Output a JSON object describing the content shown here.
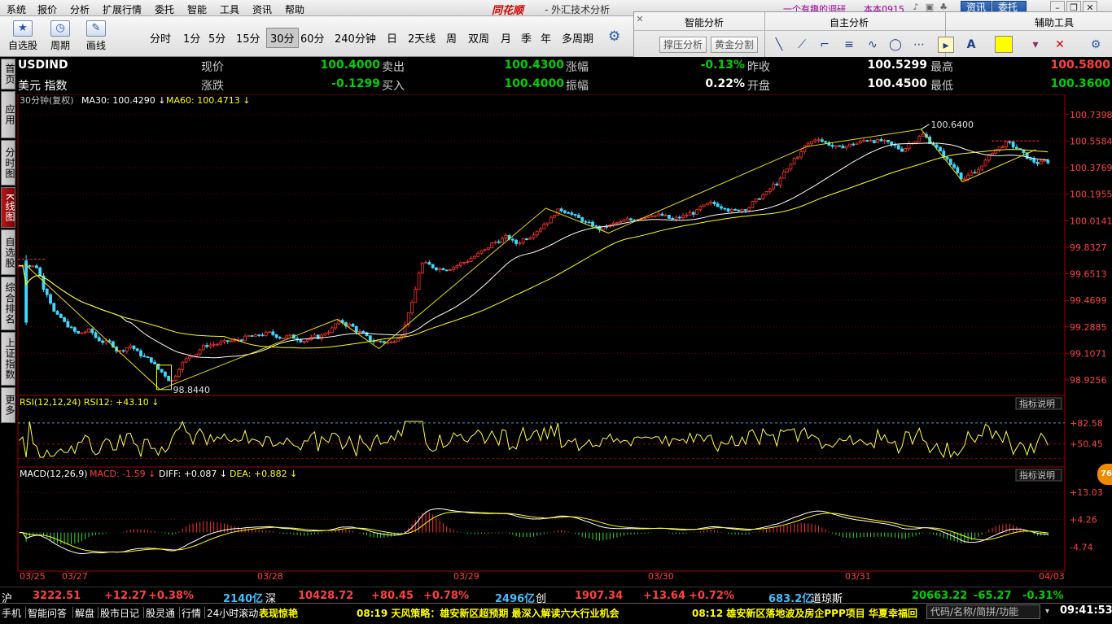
{
  "menu": {
    "items": [
      "系统",
      "报价",
      "分析",
      "扩展行情",
      "委托",
      "智能",
      "工具",
      "资讯",
      "帮助"
    ],
    "brand": "同花顺",
    "title": "- 外汇技术分析",
    "promo": "一个有趣的调研",
    "user": "本本0915",
    "news_btn": "资讯",
    "trade_btn": "委托",
    "trade_btn_arrow": "▾"
  },
  "toolbar": {
    "left_tools": [
      {
        "label": "自选股",
        "icon": "★"
      },
      {
        "label": "周期",
        "icon": "◷"
      },
      {
        "label": "画线",
        "icon": "✎"
      }
    ],
    "periods": [
      "分时",
      "1分",
      "5分",
      "15分",
      "30分",
      "60分",
      "240分钟",
      "日",
      "2天线",
      "周",
      "双周",
      "月",
      "季",
      "年",
      "多周期"
    ],
    "active_period": "30分",
    "panels": {
      "smart": "智能分析",
      "self": "自主分析",
      "aux": "辅助工具"
    },
    "smart_buttons": [
      "撑压分析",
      "黄金分割"
    ],
    "draw_icons": [
      "╲",
      "⟋",
      "⌐",
      "≡",
      "∿",
      "◯",
      "⋯"
    ],
    "pointer_icon": "▸",
    "text_icon": "A",
    "aux_icons": [
      "▾",
      "✕",
      "⚙"
    ]
  },
  "lefttabs": [
    "首页",
    "应用",
    "分时图",
    "K线图",
    "自选股",
    "综合排名",
    "上证指数",
    "更多"
  ],
  "quote": {
    "symbol": "USDIND",
    "name": "美元 指数",
    "row1": [
      {
        "label": "现价",
        "value": "100.4000",
        "color": "grn"
      },
      {
        "label": "卖出",
        "value": "100.4300",
        "color": "grn"
      },
      {
        "label": "涨幅",
        "value": "-0.13%",
        "color": "grn"
      },
      {
        "label": "昨收",
        "value": "100.5299",
        "color": "wht"
      },
      {
        "label": "最高",
        "value": "100.5800",
        "color": "red"
      }
    ],
    "row2": [
      {
        "label": "涨跌",
        "value": "-0.1299",
        "color": "grn"
      },
      {
        "label": "买入",
        "value": "100.4000",
        "color": "grn"
      },
      {
        "label": "振幅",
        "value": "0.22%",
        "color": "wht"
      },
      {
        "label": "开盘",
        "value": "100.4500",
        "color": "wht"
      },
      {
        "label": "最低",
        "value": "100.3600",
        "color": "grn"
      }
    ]
  },
  "chart_data": {
    "type": "candlestick",
    "period_label": "30分钟(复权)",
    "ma30_label": "MA30: 100.4290",
    "ma60_label": "MA60: 100.4713",
    "y_ticks": [
      "100.7398",
      "100.5584",
      "100.3769",
      "100.1955",
      "100.0141",
      "99.8327",
      "99.6513",
      "99.4699",
      "99.2885",
      "99.1071",
      "98.9256"
    ],
    "ylim": [
      98.82,
      100.8
    ],
    "x_labels": [
      "03/25",
      "03/27",
      "03/28",
      "03/29",
      "03/30",
      "03/31",
      "04/03"
    ],
    "high_annotation": "100.6400",
    "low_annotation": "98.8440",
    "close_path": [
      99.72,
      99.7,
      99.52,
      99.36,
      99.3,
      99.24,
      99.26,
      99.2,
      99.18,
      99.12,
      99.16,
      99.1,
      99.06,
      98.98,
      98.92,
      99.04,
      99.1,
      99.15,
      99.17,
      99.18,
      99.19,
      99.21,
      99.22,
      99.24,
      99.23,
      99.22,
      99.21,
      99.2,
      99.22,
      99.26,
      99.32,
      99.3,
      99.25,
      99.2,
      99.19,
      99.18,
      99.24,
      99.44,
      99.72,
      99.7,
      99.69,
      99.7,
      99.73,
      99.77,
      99.81,
      99.87,
      99.9,
      99.86,
      99.9,
      99.95,
      100.01,
      100.08,
      100.08,
      100.03,
      99.99,
      99.96,
      99.98,
      100.0,
      100.02,
      100.04,
      100.06,
      100.05,
      100.02,
      100.04,
      100.07,
      100.11,
      100.13,
      100.11,
      100.08,
      100.1,
      100.15,
      100.2,
      100.27,
      100.36,
      100.46,
      100.54,
      100.58,
      100.54,
      100.51,
      100.53,
      100.55,
      100.57,
      100.56,
      100.53,
      100.5,
      100.56,
      100.6,
      100.54,
      100.46,
      100.38,
      100.3,
      100.34,
      100.42,
      100.5,
      100.54,
      100.51,
      100.45,
      100.41,
      100.42
    ],
    "rsi": {
      "label": "RSI(12,12,24) RSI12: +43.10",
      "ticks": [
        "+82.58",
        "+50.45"
      ],
      "ylim": [
        20,
        100
      ]
    },
    "macd": {
      "label_name": "MACD(12,26,9)",
      "label_macd": "MACD: -1.59",
      "label_diff": "DIFF: +0.087",
      "label_dea": "DEA: +0.882",
      "ticks": [
        "+13.03",
        "+4.26",
        "-4.74"
      ],
      "ylim": [
        -12,
        16
      ]
    },
    "indicator_help": "指标说明"
  },
  "indexbar": [
    {
      "text": "沪",
      "color": "#ffffff"
    },
    {
      "text": "3222.51",
      "color": "#ff4040"
    },
    {
      "text": "+12.27",
      "color": "#ff4040"
    },
    {
      "text": "+0.38%",
      "color": "#ff4040"
    },
    {
      "text": "2140亿",
      "color": "#40c0ff"
    },
    {
      "text": "深",
      "color": "#ffffff"
    },
    {
      "text": "10428.72",
      "color": "#ff4040"
    },
    {
      "text": "+80.45",
      "color": "#ff4040"
    },
    {
      "text": "+0.78%",
      "color": "#ff4040"
    },
    {
      "text": "2496亿",
      "color": "#40c0ff"
    },
    {
      "text": "创",
      "color": "#ffffff"
    },
    {
      "text": "1907.34",
      "color": "#ff4040"
    },
    {
      "text": "+13.64",
      "color": "#ff4040"
    },
    {
      "text": "+0.72%",
      "color": "#ff4040"
    },
    {
      "text": "683.2亿",
      "color": "#40c0ff"
    },
    {
      "text": "道琼斯",
      "color": "#ffffff"
    },
    {
      "text": "20663.22",
      "color": "#00d000"
    },
    {
      "text": "-65.27",
      "color": "#00d000"
    },
    {
      "text": "-0.31%",
      "color": "#00d000"
    }
  ],
  "statusbar": {
    "links": [
      "手机",
      "智能问答",
      "解盘",
      "股市日记",
      "股灵通",
      "行情",
      "24小时滚动"
    ],
    "news1": "表现惊艳",
    "news2": "08:19 天风策略：雄安新区超预期 最深入解读六大行业机会",
    "news3": "08:12 雄安新区落地波及房企PPP项目 华夏幸福回",
    "code_placeholder": "代码/名称/简拼/功能",
    "clock": "09:41:53"
  },
  "badge": "76"
}
